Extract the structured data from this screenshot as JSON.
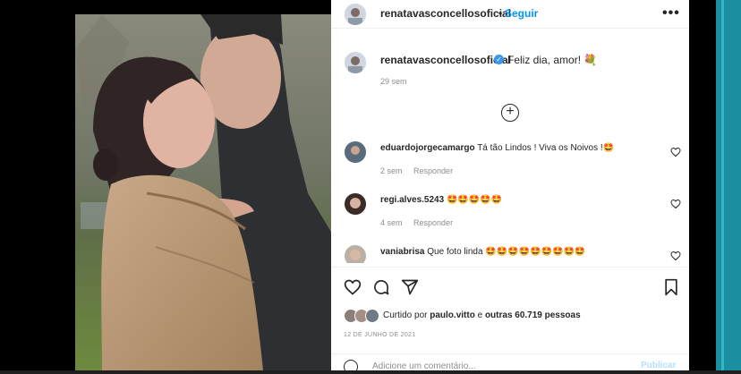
{
  "post": {
    "username": "renatavasconcellosoficial",
    "follow_label": "Seguir",
    "more_icon": "more-horizontal-icon",
    "caption_text": "Feliz dia, amor! 💐",
    "caption_time": "29 sem",
    "verified_icon": "verified-badge-icon",
    "load_more_icon": "plus-circle-icon"
  },
  "comments": [
    {
      "username": "eduardojorgecamargo",
      "text": "Tá tão Lindos ! Viva os Noivos !🤩",
      "time": "2 sem",
      "reply": "Responder"
    },
    {
      "username": "regi.alves.5243",
      "text": "🤩🤩🤩🤩🤩",
      "time": "4 sem",
      "reply": "Responder"
    },
    {
      "username": "vaniabrisa",
      "text": "Que foto linda 🤩🤩🤩🤩🤩🤩🤩🤩🤩",
      "time": "",
      "reply": ""
    }
  ],
  "actions": {
    "like_icon": "heart-icon",
    "comment_icon": "comment-icon",
    "share_icon": "send-icon",
    "save_icon": "bookmark-icon"
  },
  "likes": {
    "prefix": "Curtido por ",
    "user": "paulo.vitto",
    "middle": " e ",
    "others": "outras 60.719 pessoas"
  },
  "date": "12 DE JUNHO DE 2021",
  "add_comment": {
    "placeholder": "Adicione um comentário...",
    "publish_label": "Publicar"
  },
  "colors": {
    "accent": "#0095f6",
    "teal_scrollbar": "#1b8fa0"
  }
}
